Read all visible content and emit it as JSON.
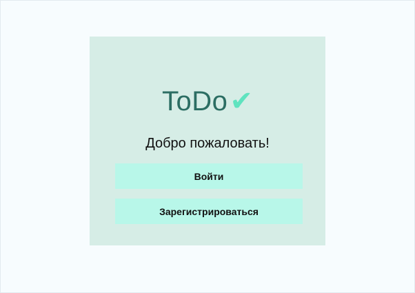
{
  "logo": {
    "text": "ToDo",
    "icon": "check-icon",
    "icon_glyph": "✔",
    "text_color": "#2c6e63",
    "icon_color": "#5fe3bf"
  },
  "welcome": {
    "title": "Добро пожаловать!"
  },
  "actions": {
    "login_label": "Войти",
    "register_label": "Зарегистрироваться"
  },
  "colors": {
    "card_background": "#d6ede6",
    "button_background": "#b8f7e9",
    "page_background": "#f7fcfe"
  }
}
